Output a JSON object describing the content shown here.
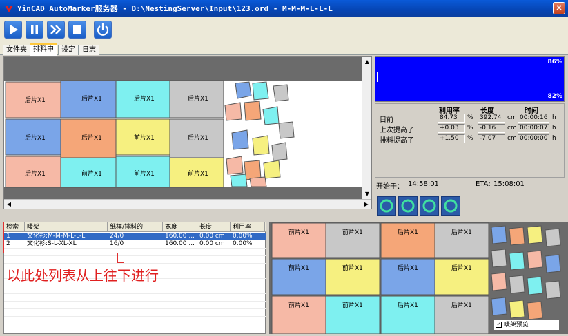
{
  "window": {
    "title": "YinCAD AutoMarker服务器 - D:\\NestingServer\\Input\\123.ord - M-M-M-L-L-L",
    "close_label": "×"
  },
  "toolbar": {
    "buttons": [
      "play-icon",
      "pause-icon",
      "fast-forward-icon",
      "stop-icon",
      "power-icon"
    ]
  },
  "tabs": [
    "文件夹",
    "排料中",
    "设定",
    "日志"
  ],
  "active_tab": "排料中",
  "graph": {
    "top_label": "86%",
    "bottom_label": "82%",
    "color": "#0000ff"
  },
  "stats": {
    "headers": [
      "利用率",
      "长度",
      "时间"
    ],
    "rows": [
      {
        "label": "目前",
        "util": "84.73",
        "util_unit": "%",
        "len": "392.74",
        "len_unit": "cm",
        "time": "00:00:16",
        "time_unit": "h"
      },
      {
        "label": "上次提高了",
        "util": "+0.03",
        "util_unit": "%",
        "len": "-0.16",
        "len_unit": "cm",
        "time": "00:00:07",
        "time_unit": "h"
      },
      {
        "label": "排料提高了",
        "util": "+1.50",
        "util_unit": "%",
        "len": "-7.07",
        "len_unit": "cm",
        "time": "00:00:00",
        "time_unit": "h"
      }
    ],
    "start_label": "开始于：",
    "start_time": "14:58:01",
    "eta_label": "ETA:",
    "eta_time": "15:08:01"
  },
  "list": {
    "headers": [
      "检索",
      "唛架",
      "纸样/排料的",
      "宽度",
      "长度",
      "利用率"
    ],
    "rows": [
      {
        "index": "1",
        "name": "文化衫:M-M-M-L-L-L",
        "pieces": "24/0",
        "width": "160.00 ...",
        "length": "0.00 cm",
        "util": "0.00%",
        "selected": true
      },
      {
        "index": "2",
        "name": "文化衫:S-L-XL-XL",
        "pieces": "16/0",
        "width": "160.00 ...",
        "length": "0.00 cm",
        "util": "0.00%",
        "selected": false
      }
    ]
  },
  "annotation": {
    "text": "以此处列表从上往下进行",
    "color": "#e02020"
  },
  "preview": {
    "checkbox_label": "唛架预览",
    "checked": true
  },
  "marker_labels": [
    "后片X1",
    "前片X1"
  ]
}
